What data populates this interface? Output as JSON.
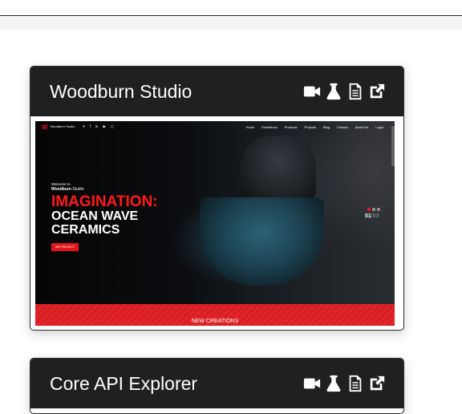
{
  "cards": [
    {
      "title": "Woodburn Studio",
      "actions": [
        {
          "icon": "video-icon"
        },
        {
          "icon": "flask-icon"
        },
        {
          "icon": "document-icon"
        },
        {
          "icon": "external-link-icon"
        }
      ],
      "preview": {
        "logo_mark": "W",
        "logo_text": "Woodburn Studio",
        "social": [
          "twitter-icon",
          "facebook-icon",
          "linkedin-icon",
          "youtube-icon",
          "instagram-icon"
        ],
        "menu": [
          "Home",
          "Exhibitions",
          "Products",
          "Projects",
          "Blog",
          "Contact",
          "About Us",
          "Login"
        ],
        "welcome": "Welcome to",
        "brand_bold": "Woodburn",
        "brand_rest": " Studio",
        "headline": "IMAGINATION:",
        "line1": "OCEAN WAVE",
        "line2": "CERAMICS",
        "button": "SEE PROJECT",
        "slide_current": "01",
        "slide_total": "/03",
        "banner": "NEW CREATIONS"
      }
    },
    {
      "title": "Core API Explorer",
      "actions": [
        {
          "icon": "video-icon"
        },
        {
          "icon": "flask-icon"
        },
        {
          "icon": "document-icon"
        },
        {
          "icon": "external-link-icon"
        }
      ]
    }
  ],
  "colors": {
    "card_header": "#202020",
    "accent_red": "#e0141b"
  }
}
